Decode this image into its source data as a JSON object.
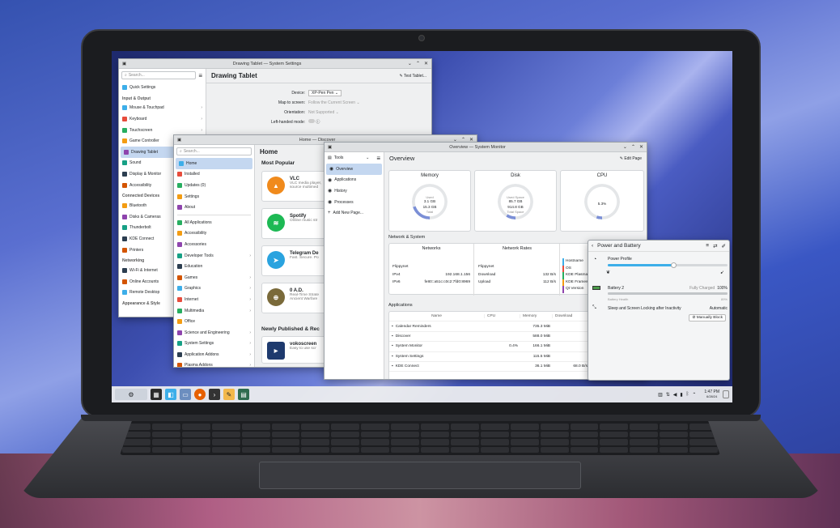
{
  "settings": {
    "title": "Drawing Tablet — System Settings",
    "search_placeholder": "Search...",
    "page_title": "Drawing Tablet",
    "test_button": "Test Tablet...",
    "quick": "Quick Settings",
    "sections": [
      {
        "header": "Input & Output",
        "items": [
          "Mouse & Touchpad",
          "Keyboard",
          "Touchscreen",
          "Game Controller",
          "Drawing Tablet",
          "Sound",
          "Display & Monitor",
          "Accessibility"
        ]
      },
      {
        "header": "Connected Devices",
        "items": [
          "Bluetooth",
          "Disks & Cameras",
          "Thunderbolt",
          "KDE Connect",
          "Printers"
        ]
      },
      {
        "header": "Networking",
        "items": [
          "Wi-Fi & Internet",
          "Online Accounts",
          "Remote Desktop"
        ]
      },
      {
        "header": "Appearance & Style",
        "items": []
      }
    ],
    "form": {
      "device_label": "Device:",
      "device_value": "XP-Pen Pen",
      "map_label": "Map to screen:",
      "map_value": "Follow the Current Screen",
      "orient_label": "Orientation:",
      "orient_value": "Not Supported",
      "lefthand_label": "Left-handed mode:"
    }
  },
  "discover": {
    "title": "Home — Discover",
    "search_placeholder": "Search...",
    "page_title": "Home",
    "nav": [
      "Home",
      "Installed",
      "Updates (0)",
      "Settings",
      "About"
    ],
    "categories": [
      "All Applications",
      "Accessibility",
      "Accessories",
      "Developer Tools",
      "Education",
      "Games",
      "Graphics",
      "Internet",
      "Multimedia",
      "Office",
      "Science and Engineering",
      "System Settings",
      "Application Addons",
      "Plasma Addons"
    ],
    "most_popular": "Most Popular",
    "apps": [
      {
        "name": "VLC",
        "desc": "VLC media player,",
        "desc2": "source multimed",
        "color": "#f08a1c",
        "glyph": "▲"
      },
      {
        "name": "Spotify",
        "desc": "Online music str",
        "desc2": "",
        "color": "#1db954",
        "glyph": "≋"
      },
      {
        "name": "Telegram De",
        "desc": "Fast. Secure. Po",
        "desc2": "",
        "color": "#2aa3df",
        "glyph": "➤"
      },
      {
        "name": "0 A.D.",
        "desc": "Real-Time Strate",
        "desc2": "Ancient Warfare",
        "color": "#7a6a3a",
        "glyph": "⊕"
      }
    ],
    "newly_published": "Newly Published & Rec",
    "new_app": {
      "name": "vokoscreen",
      "desc": "Easy to use scr"
    }
  },
  "monitor": {
    "title": "Overview — System Monitor",
    "tools": "Tools",
    "nav": [
      "Overview",
      "Applications",
      "History",
      "Processes",
      "Add New Page..."
    ],
    "page_title": "Overview",
    "edit_page": "Edit Page",
    "memory": {
      "title": "Memory",
      "used_label": "Used",
      "used": "3.1 GB",
      "total": "15.3 GB",
      "total_label": "Total",
      "fraction": 0.2
    },
    "disk": {
      "title": "Disk",
      "used_label": "Used Space",
      "used": "85.7 GB",
      "total": "914.8 GB",
      "total_label": "Total Space",
      "fraction": 0.09
    },
    "cpu": {
      "title": "CPU",
      "value": "5.3%",
      "fraction": 0.053
    },
    "network_section": "Network & System",
    "networks_title": "Networks",
    "rates_title": "Network Rates",
    "net_name": "Flippynet",
    "ipv4_label": "IPv4",
    "ipv4": "192.168.1.156",
    "ipv6_label": "IPv6",
    "ipv6": "fe80::a51c:c0c2:7fd0:8969",
    "rate_name": "Flippynet",
    "download_label": "Download",
    "download": "132 B/s",
    "upload_label": "Upload",
    "upload": "112 B/s",
    "sys_labels": [
      "Hostname",
      "OS",
      "KDE Plasma",
      "KDE Framew",
      "Qt Version"
    ],
    "apps_section": "Applications",
    "columns": [
      "Name",
      "CPU",
      "Memory",
      "Download",
      "Upload"
    ],
    "rows": [
      {
        "name": "Calendar Reminders",
        "cpu": "",
        "mem": "735.3 MiB",
        "down": "",
        "up": ""
      },
      {
        "name": "Discover",
        "cpu": "",
        "mem": "588.0 MiB",
        "down": "",
        "up": ""
      },
      {
        "name": "System Monitor",
        "cpu": "0.4%",
        "mem": "166.1 MiB",
        "down": "",
        "up": ""
      },
      {
        "name": "System Settings",
        "cpu": "",
        "mem": "115.5 MiB",
        "down": "",
        "up": ""
      },
      {
        "name": "KDE Connect",
        "cpu": "",
        "mem": "36.1 MiB",
        "down": "68.0 B/s",
        "up": "68.0 B/s"
      }
    ]
  },
  "power": {
    "title": "Power and Battery",
    "profile_label": "Power Profile",
    "profile_fraction": 0.55,
    "battery_label": "Battery 2",
    "battery_status": "Fully Charged",
    "battery_pct": "100%",
    "health_label": "Battery Health",
    "health_pct": "89%",
    "sleep_label": "Sleep and Screen Locking after Inactivity",
    "sleep_value": "Automatic",
    "manual_block": "Manually Block"
  },
  "taskbar": {
    "time": "1:47 PM",
    "date": "6/28/24"
  }
}
